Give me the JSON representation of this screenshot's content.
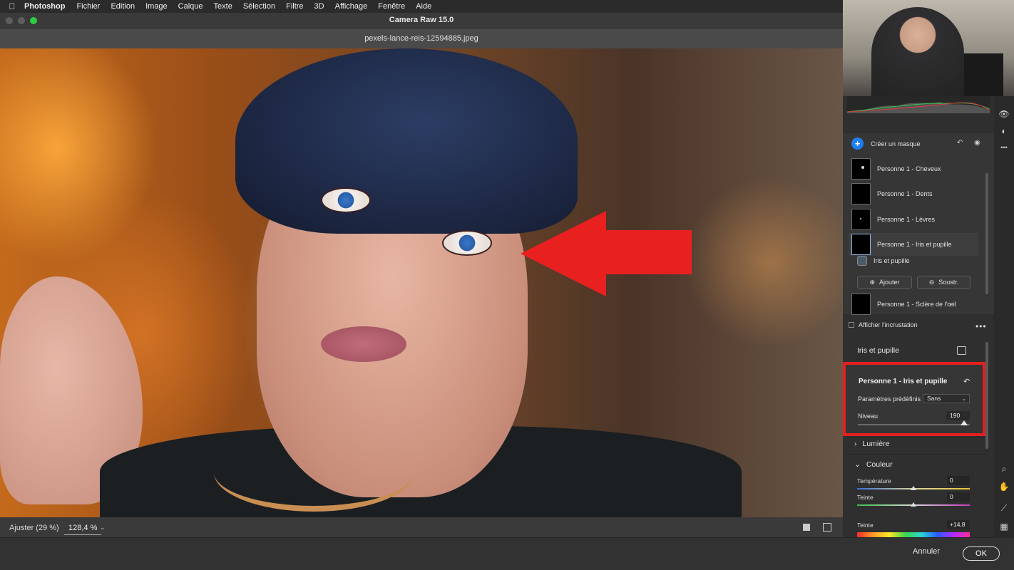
{
  "menubar": {
    "apple": "",
    "app": "Photoshop",
    "items": [
      "Fichier",
      "Edition",
      "Image",
      "Calque",
      "Texte",
      "Sélection",
      "Filtre",
      "3D",
      "Affichage",
      "Fenêtre",
      "Aide"
    ]
  },
  "window": {
    "title": "Camera Raw 15.0",
    "filename": "pexels-lance-reis-12594885.jpeg"
  },
  "statusbar": {
    "fit": "Ajuster (29 %)",
    "zoom": "128,4 %",
    "zoom_caret": "⌄"
  },
  "footer": {
    "cancel": "Annuler",
    "ok": "OK"
  },
  "masks": {
    "create_label": "Créer un masque",
    "plus": "+",
    "items": [
      {
        "label": "Personne 1 - Cheveux"
      },
      {
        "label": "Personne 1 - Dents"
      },
      {
        "label": "Personne 1 - Lèvres"
      },
      {
        "label": "Personne 1 - Iris et pupille"
      },
      {
        "label": "Personne 1 - Sclère de l'œil"
      }
    ],
    "sub_item": "Iris et pupille",
    "add_label": "Ajouter",
    "subtract_label": "Soustr.",
    "overlay_label": "Afficher l'incrustation",
    "more": "•••"
  },
  "adjust": {
    "section_title": "Iris et pupille",
    "panel_title": "Personne 1 - Iris et pupille",
    "reset_icon": "↶",
    "preset_label": "Paramètres prédéfinis",
    "preset_value": "Sans",
    "preset_caret": "⌄",
    "level_label": "Niveau",
    "level_value": "190",
    "level_fraction": 0.95
  },
  "sections": {
    "lumiere": "Lumière",
    "couleur": "Couleur",
    "chevron_right": "›",
    "chevron_down": "⌄"
  },
  "color": {
    "temperature_label": "Température",
    "temperature_value": "0",
    "tint_label": "Teinte",
    "tint_value": "0",
    "hue_label": "Teinte",
    "hue_value": "+14,8"
  },
  "tools": {
    "icons": [
      "eye-icon",
      "mask-icon",
      "more-icon",
      "zoom-icon",
      "hand-icon",
      "sampler-icon",
      "grid-icon"
    ],
    "glyphs": [
      "👁",
      "◐",
      "•••",
      "⌕",
      "✋",
      "⟋",
      "▦"
    ]
  },
  "colors": {
    "accent_blue": "#1e7ef0",
    "highlight_red": "#e2201f",
    "arrow_red": "#e8201f"
  }
}
